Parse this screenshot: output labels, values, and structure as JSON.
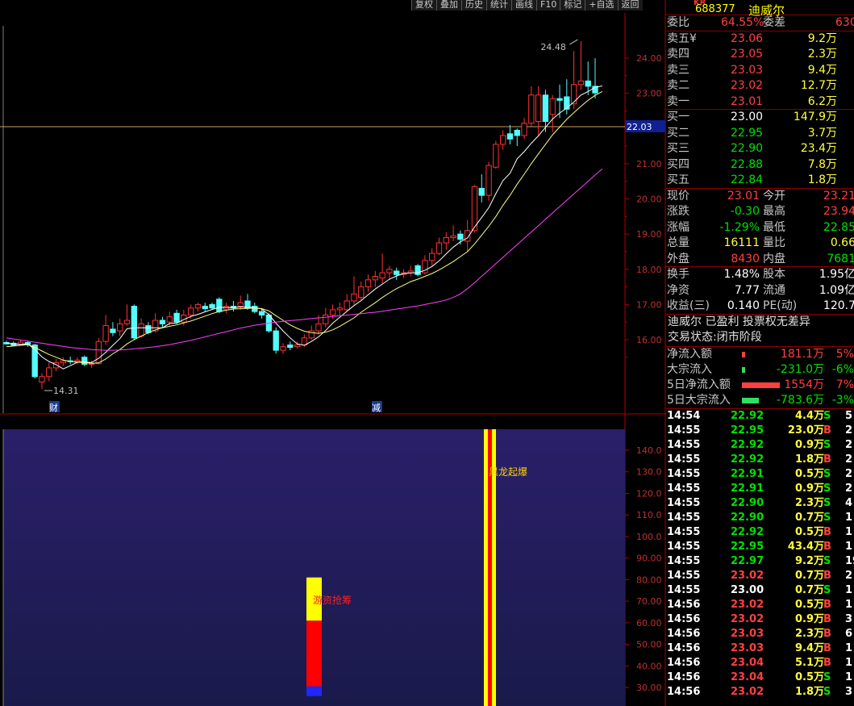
{
  "toolbar": {
    "buttons": [
      "复权",
      "叠加",
      "历史",
      "统计",
      "画线",
      "F10",
      "标记",
      "+自选",
      "返回"
    ]
  },
  "chart_data": {
    "type": "candlestick",
    "ylim": [
      15.5,
      24.8
    ],
    "y_ticks": [
      "24.00",
      "23.00",
      "22.00",
      "21.00",
      "20.00",
      "19.00",
      "18.00",
      "17.00",
      "16.00"
    ],
    "current_price_label": "22.03",
    "high_marker": "24.48",
    "low_marker": "14.31",
    "bottom_markers": [
      "财",
      "减"
    ],
    "candles": [
      {
        "o": 15.92,
        "c": 15.88,
        "h": 15.97,
        "l": 15.86
      },
      {
        "o": 15.9,
        "c": 15.84,
        "h": 15.95,
        "l": 15.82
      },
      {
        "o": 15.86,
        "c": 15.93,
        "h": 15.98,
        "l": 15.83
      },
      {
        "o": 15.92,
        "c": 15.86,
        "h": 15.96,
        "l": 15.8
      },
      {
        "o": 15.85,
        "c": 14.95,
        "h": 15.88,
        "l": 14.9
      },
      {
        "o": 14.8,
        "c": 14.95,
        "h": 15.05,
        "l": 14.6
      },
      {
        "o": 14.95,
        "c": 15.2,
        "h": 15.35,
        "l": 14.82
      },
      {
        "o": 15.2,
        "c": 15.35,
        "h": 15.45,
        "l": 15.1
      },
      {
        "o": 15.35,
        "c": 15.4,
        "h": 15.5,
        "l": 15.25
      },
      {
        "o": 15.4,
        "c": 15.38,
        "h": 15.52,
        "l": 15.3
      },
      {
        "o": 15.38,
        "c": 15.42,
        "h": 15.5,
        "l": 15.3
      },
      {
        "o": 15.5,
        "c": 15.3,
        "h": 15.55,
        "l": 15.25
      },
      {
        "o": 15.3,
        "c": 15.32,
        "h": 15.4,
        "l": 15.2
      },
      {
        "o": 15.32,
        "c": 15.95,
        "h": 16.05,
        "l": 15.3
      },
      {
        "o": 15.95,
        "c": 16.4,
        "h": 16.7,
        "l": 15.85
      },
      {
        "o": 16.3,
        "c": 16.2,
        "h": 16.5,
        "l": 16.1
      },
      {
        "o": 16.25,
        "c": 16.45,
        "h": 16.6,
        "l": 16.1
      },
      {
        "o": 16.45,
        "c": 16.55,
        "h": 17.0,
        "l": 16.4
      },
      {
        "o": 16.95,
        "c": 16.05,
        "h": 17.0,
        "l": 16.0
      },
      {
        "o": 16.1,
        "c": 16.45,
        "h": 16.6,
        "l": 16.05
      },
      {
        "o": 16.4,
        "c": 16.2,
        "h": 16.5,
        "l": 16.15
      },
      {
        "o": 16.25,
        "c": 16.55,
        "h": 16.75,
        "l": 16.2
      },
      {
        "o": 16.55,
        "c": 16.45,
        "h": 16.65,
        "l": 16.35
      },
      {
        "o": 16.5,
        "c": 16.65,
        "h": 16.8,
        "l": 16.4
      },
      {
        "o": 16.75,
        "c": 16.5,
        "h": 16.85,
        "l": 16.45
      },
      {
        "o": 16.5,
        "c": 16.7,
        "h": 16.85,
        "l": 16.4
      },
      {
        "o": 16.7,
        "c": 16.9,
        "h": 17.0,
        "l": 16.6
      },
      {
        "o": 16.9,
        "c": 17.0,
        "h": 17.05,
        "l": 16.8
      },
      {
        "o": 16.95,
        "c": 16.88,
        "h": 17.05,
        "l": 16.8
      },
      {
        "o": 17.0,
        "c": 16.9,
        "h": 17.05,
        "l": 16.85
      },
      {
        "o": 17.15,
        "c": 16.8,
        "h": 17.2,
        "l": 16.75
      },
      {
        "o": 16.85,
        "c": 16.95,
        "h": 17.05,
        "l": 16.75
      },
      {
        "o": 16.95,
        "c": 16.9,
        "h": 17.1,
        "l": 16.8
      },
      {
        "o": 16.95,
        "c": 17.05,
        "h": 17.25,
        "l": 16.85
      },
      {
        "o": 17.1,
        "c": 16.9,
        "h": 17.3,
        "l": 16.85
      },
      {
        "o": 16.95,
        "c": 16.8,
        "h": 17.05,
        "l": 16.75
      },
      {
        "o": 16.8,
        "c": 16.7,
        "h": 16.9,
        "l": 16.6
      },
      {
        "o": 16.7,
        "c": 16.25,
        "h": 16.75,
        "l": 16.2
      },
      {
        "o": 16.25,
        "c": 15.7,
        "h": 16.35,
        "l": 15.6
      },
      {
        "o": 15.7,
        "c": 15.8,
        "h": 15.9,
        "l": 15.6
      },
      {
        "o": 15.85,
        "c": 15.78,
        "h": 15.95,
        "l": 15.7
      },
      {
        "o": 15.8,
        "c": 15.85,
        "h": 15.95,
        "l": 15.75
      },
      {
        "o": 15.85,
        "c": 16.05,
        "h": 16.15,
        "l": 15.8
      },
      {
        "o": 16.05,
        "c": 16.25,
        "h": 16.4,
        "l": 16.0
      },
      {
        "o": 16.25,
        "c": 16.45,
        "h": 16.7,
        "l": 16.15
      },
      {
        "o": 16.45,
        "c": 16.7,
        "h": 16.9,
        "l": 16.35
      },
      {
        "o": 16.7,
        "c": 16.85,
        "h": 17.0,
        "l": 16.6
      },
      {
        "o": 16.85,
        "c": 16.9,
        "h": 17.05,
        "l": 16.7
      },
      {
        "o": 16.85,
        "c": 17.1,
        "h": 17.3,
        "l": 16.8
      },
      {
        "o": 17.1,
        "c": 17.3,
        "h": 17.8,
        "l": 17.0
      },
      {
        "o": 17.2,
        "c": 17.5,
        "h": 17.65,
        "l": 17.1
      },
      {
        "o": 17.5,
        "c": 17.7,
        "h": 17.85,
        "l": 17.35
      },
      {
        "o": 17.7,
        "c": 17.8,
        "h": 17.95,
        "l": 17.5
      },
      {
        "o": 17.75,
        "c": 17.9,
        "h": 18.45,
        "l": 17.6
      },
      {
        "o": 17.9,
        "c": 18.0,
        "h": 18.1,
        "l": 17.7
      },
      {
        "o": 17.95,
        "c": 17.85,
        "h": 18.05,
        "l": 17.7
      },
      {
        "o": 17.85,
        "c": 17.9,
        "h": 18.0,
        "l": 17.75
      },
      {
        "o": 17.9,
        "c": 17.95,
        "h": 18.1,
        "l": 17.8
      },
      {
        "o": 18.1,
        "c": 17.85,
        "h": 18.15,
        "l": 17.8
      },
      {
        "o": 17.9,
        "c": 18.25,
        "h": 18.4,
        "l": 17.85
      },
      {
        "o": 18.25,
        "c": 18.45,
        "h": 18.6,
        "l": 18.1
      },
      {
        "o": 18.45,
        "c": 18.75,
        "h": 18.9,
        "l": 18.4
      },
      {
        "o": 18.75,
        "c": 18.9,
        "h": 19.05,
        "l": 18.55
      },
      {
        "o": 18.9,
        "c": 18.95,
        "h": 19.25,
        "l": 18.8
      },
      {
        "o": 19.0,
        "c": 18.85,
        "h": 19.1,
        "l": 18.7
      },
      {
        "o": 18.8,
        "c": 19.1,
        "h": 19.4,
        "l": 18.5
      },
      {
        "o": 19.1,
        "c": 20.35,
        "h": 20.4,
        "l": 19.05
      },
      {
        "o": 20.3,
        "c": 20.1,
        "h": 20.7,
        "l": 19.9
      },
      {
        "o": 20.1,
        "c": 20.95,
        "h": 21.05,
        "l": 19.95
      },
      {
        "o": 20.9,
        "c": 21.55,
        "h": 21.65,
        "l": 20.85
      },
      {
        "o": 21.55,
        "c": 21.8,
        "h": 21.95,
        "l": 21.4
      },
      {
        "o": 21.85,
        "c": 21.7,
        "h": 22.1,
        "l": 21.55
      },
      {
        "o": 21.95,
        "c": 21.8,
        "h": 22.0,
        "l": 21.5
      },
      {
        "o": 21.8,
        "c": 22.15,
        "h": 22.3,
        "l": 21.7
      },
      {
        "o": 22.15,
        "c": 22.95,
        "h": 23.2,
        "l": 22.05
      },
      {
        "o": 22.2,
        "c": 22.95,
        "h": 23.2,
        "l": 21.8
      },
      {
        "o": 22.95,
        "c": 22.2,
        "h": 23.1,
        "l": 21.9
      },
      {
        "o": 22.4,
        "c": 22.85,
        "h": 22.95,
        "l": 21.9
      },
      {
        "o": 22.85,
        "c": 22.8,
        "h": 23.25,
        "l": 22.3
      },
      {
        "o": 22.9,
        "c": 22.55,
        "h": 23.4,
        "l": 22.4
      },
      {
        "o": 22.7,
        "c": 23.25,
        "h": 24.2,
        "l": 22.55
      },
      {
        "o": 23.25,
        "c": 23.35,
        "h": 24.48,
        "l": 23.1
      },
      {
        "o": 23.35,
        "c": 23.2,
        "h": 23.9,
        "l": 22.95
      },
      {
        "o": 23.2,
        "c": 23.01,
        "h": 24.0,
        "l": 22.85
      }
    ],
    "ma_series": [
      {
        "name": "MA5",
        "color": "#ffffff",
        "values": [
          15.9,
          15.88,
          15.87,
          15.88,
          15.72,
          15.51,
          15.38,
          15.29,
          15.17,
          15.26,
          15.36,
          15.37,
          15.35,
          15.47,
          15.64,
          15.84,
          16.03,
          16.31,
          16.34,
          16.34,
          16.34,
          16.34,
          16.34,
          16.46,
          16.47,
          16.57,
          16.66,
          16.72,
          16.79,
          16.86,
          16.92,
          16.91,
          16.91,
          16.93,
          16.92,
          16.92,
          16.87,
          16.71,
          16.47,
          16.25,
          16.05,
          15.88,
          15.84,
          15.95,
          16.08,
          16.26,
          16.47,
          16.64,
          16.81,
          16.97,
          17.11,
          17.28,
          17.44,
          17.58,
          17.72,
          17.81,
          17.88,
          17.9,
          17.9,
          17.97,
          18.08,
          18.24,
          18.44,
          18.63,
          18.78,
          18.89,
          19.2,
          19.47,
          19.75,
          20.15,
          20.52,
          20.73,
          21.14,
          21.34,
          21.58,
          21.79,
          22.03,
          22.27,
          22.44,
          22.58,
          22.75,
          22.95,
          23.05,
          23.17,
          23.21
        ]
      },
      {
        "name": "MA10",
        "color": "#ffff80",
        "values": [
          15.8,
          15.82,
          15.84,
          15.86,
          15.78,
          15.68,
          15.58,
          15.5,
          15.42,
          15.38,
          15.36,
          15.35,
          15.33,
          15.34,
          15.45,
          15.6,
          15.72,
          15.88,
          16.0,
          16.1,
          16.2,
          16.28,
          16.34,
          16.38,
          16.42,
          16.48,
          16.53,
          16.6,
          16.67,
          16.74,
          16.8,
          16.84,
          16.87,
          16.88,
          16.89,
          16.9,
          16.88,
          16.82,
          16.68,
          16.55,
          16.42,
          16.32,
          16.24,
          16.2,
          16.18,
          16.21,
          16.28,
          16.38,
          16.5,
          16.62,
          16.78,
          16.92,
          17.05,
          17.2,
          17.33,
          17.45,
          17.55,
          17.65,
          17.72,
          17.8,
          17.88,
          17.98,
          18.1,
          18.22,
          18.36,
          18.5,
          18.72,
          18.97,
          19.22,
          19.5,
          19.82,
          20.1,
          20.42,
          20.7,
          21.0,
          21.28,
          21.55,
          21.82,
          22.04,
          22.26,
          22.45,
          22.63,
          22.8,
          22.94,
          23.05
        ]
      },
      {
        "name": "MA60",
        "color": "#ff40ff",
        "values": [
          16.05,
          16.02,
          15.99,
          15.96,
          15.93,
          15.9,
          15.87,
          15.84,
          15.81,
          15.78,
          15.76,
          15.74,
          15.72,
          15.71,
          15.7,
          15.7,
          15.71,
          15.72,
          15.74,
          15.76,
          15.78,
          15.8,
          15.83,
          15.86,
          15.9,
          15.94,
          15.98,
          16.03,
          16.08,
          16.13,
          16.18,
          16.23,
          16.28,
          16.33,
          16.37,
          16.41,
          16.44,
          16.47,
          16.5,
          16.52,
          16.54,
          16.56,
          16.58,
          16.6,
          16.62,
          16.64,
          16.66,
          16.68,
          16.7,
          16.72,
          16.74,
          16.76,
          16.78,
          16.81,
          16.84,
          16.87,
          16.9,
          16.93,
          16.96,
          17.0,
          17.04,
          17.08,
          17.13,
          17.2,
          17.3,
          17.45,
          17.62,
          17.8,
          17.98,
          18.16,
          18.34,
          18.52,
          18.7,
          18.88,
          19.06,
          19.24,
          19.42,
          19.6,
          19.78,
          19.96,
          20.14,
          20.32,
          20.5,
          20.68,
          20.85
        ]
      }
    ],
    "indicator": {
      "y_ticks": [
        "140.0",
        "130.0",
        "120.0",
        "110.0",
        "100.0",
        "90.00",
        "80.00",
        "70.00",
        "60.00",
        "50.00",
        "40.00",
        "30.00"
      ],
      "ylim": [
        26,
        150
      ],
      "labels": [
        "游资抢筹",
        "黑龙起爆"
      ],
      "bar_segments": [
        {
          "name": "blue-segment",
          "from": 26,
          "to": 30.5,
          "color": "#1f28ff"
        },
        {
          "name": "red-segment",
          "from": 30.5,
          "to": 61,
          "color": "#ff0000"
        },
        {
          "name": "yellow-segment",
          "from": 61,
          "to": 81,
          "color": "#ffff00"
        }
      ],
      "vertical_band": {
        "outer_color": "#ffff00",
        "inner_color": "#ff0000"
      }
    }
  },
  "panel": {
    "market_tag": "KR",
    "code": "688377",
    "name": "迪威尔",
    "ratio": {
      "label1": "委比",
      "value1": "64.55%",
      "label2": "委差",
      "value2": "630"
    },
    "asks": [
      {
        "label": "卖五",
        "mark": "¥",
        "price": "23.06",
        "vol": "9.2万"
      },
      {
        "label": "卖四",
        "mark": "",
        "price": "23.05",
        "vol": "2.3万"
      },
      {
        "label": "卖三",
        "mark": "",
        "price": "23.03",
        "vol": "9.4万"
      },
      {
        "label": "卖二",
        "mark": "",
        "price": "23.02",
        "vol": "12.7万"
      },
      {
        "label": "卖一",
        "mark": "",
        "price": "23.01",
        "vol": "6.2万"
      }
    ],
    "bids": [
      {
        "label": "买一",
        "price": "23.00",
        "vol": "147.9万"
      },
      {
        "label": "买二",
        "price": "22.95",
        "vol": "3.7万"
      },
      {
        "label": "买三",
        "price": "22.90",
        "vol": "23.4万"
      },
      {
        "label": "买四",
        "price": "22.88",
        "vol": "7.8万"
      },
      {
        "label": "买五",
        "price": "22.84",
        "vol": "1.8万"
      }
    ],
    "quotes": [
      {
        "l1": "现价",
        "v1": "23.01",
        "c1": "red",
        "l2": "今开",
        "v2": "23.21",
        "c2": "red"
      },
      {
        "l1": "涨跌",
        "v1": "-0.30",
        "c1": "green",
        "l2": "最高",
        "v2": "23.94",
        "c2": "red"
      },
      {
        "l1": "涨幅",
        "v1": "-1.29%",
        "c1": "green",
        "l2": "最低",
        "v2": "22.85",
        "c2": "green"
      },
      {
        "l1": "总量",
        "v1": "16111",
        "c1": "yellow",
        "l2": "量比",
        "v2": "0.66",
        "c2": "yellow"
      },
      {
        "l1": "外盘",
        "v1": "8430",
        "c1": "red",
        "l2": "内盘",
        "v2": "7681",
        "c2": "green"
      }
    ],
    "stats": [
      {
        "l1": "换手",
        "v1": "1.48%",
        "l2": "股本",
        "v2": "1.95亿"
      },
      {
        "l1": "净资",
        "v1": "7.77",
        "l2": "流通",
        "v2": "1.09亿"
      },
      {
        "l1": "收益(三)",
        "v1": "0.140",
        "l2": "PE(动)",
        "v2": "120.7"
      }
    ],
    "note_line1": "迪威尔 已盈利 投票权无差异",
    "note_line2": "交易状态:闭市阶段",
    "flows": [
      {
        "label": "净流入额",
        "value": "181.1万",
        "pct": "5%",
        "color": "red",
        "bar": 0.04
      },
      {
        "label": "大宗流入",
        "value": "-231.0万",
        "pct": "-6%",
        "color": "green",
        "bar": 0.04
      },
      {
        "label": "5日净流入额",
        "value": "1554万",
        "pct": "7%",
        "color": "red",
        "bar": 0.9
      },
      {
        "label": "5日大宗流入",
        "value": "-783.6万",
        "pct": "-3%",
        "color": "green",
        "bar": 0.4
      }
    ],
    "ticks": [
      {
        "t": "14:54",
        "p": "22.92",
        "v": "4.4万",
        "s": "S",
        "n": "5"
      },
      {
        "t": "14:55",
        "p": "22.95",
        "v": "23.0万",
        "s": "B",
        "n": "2"
      },
      {
        "t": "14:55",
        "p": "22.92",
        "v": "0.9万",
        "s": "S",
        "n": "2"
      },
      {
        "t": "14:55",
        "p": "22.92",
        "v": "1.8万",
        "s": "B",
        "n": "2"
      },
      {
        "t": "14:55",
        "p": "22.91",
        "v": "0.5万",
        "s": "S",
        "n": "2"
      },
      {
        "t": "14:55",
        "p": "22.91",
        "v": "0.9万",
        "s": "S",
        "n": "2"
      },
      {
        "t": "14:55",
        "p": "22.90",
        "v": "2.3万",
        "s": "S",
        "n": "4"
      },
      {
        "t": "14:55",
        "p": "22.90",
        "v": "0.7万",
        "s": "S",
        "n": "1"
      },
      {
        "t": "14:55",
        "p": "22.92",
        "v": "0.5万",
        "s": "B",
        "n": "1"
      },
      {
        "t": "14:55",
        "p": "22.95",
        "v": "43.4万",
        "s": "B",
        "n": "1"
      },
      {
        "t": "14:55",
        "p": "22.97",
        "v": "9.2万",
        "s": "S",
        "n": "19"
      },
      {
        "t": "14:55",
        "p": "23.02",
        "v": "0.7万",
        "s": "B",
        "n": "2"
      },
      {
        "t": "14:55",
        "p": "23.00",
        "v": "0.7万",
        "s": "S",
        "n": "1"
      },
      {
        "t": "14:56",
        "p": "23.02",
        "v": "0.5万",
        "s": "B",
        "n": "1"
      },
      {
        "t": "14:56",
        "p": "23.02",
        "v": "0.9万",
        "s": "B",
        "n": "3"
      },
      {
        "t": "14:56",
        "p": "23.03",
        "v": "2.3万",
        "s": "B",
        "n": "6"
      },
      {
        "t": "14:56",
        "p": "23.03",
        "v": "9.4万",
        "s": "B",
        "n": "1"
      },
      {
        "t": "14:56",
        "p": "23.04",
        "v": "5.1万",
        "s": "B",
        "n": "1"
      },
      {
        "t": "14:56",
        "p": "23.04",
        "v": "0.5万",
        "s": "S",
        "n": "1"
      },
      {
        "t": "14:56",
        "p": "23.02",
        "v": "1.8万",
        "s": "S",
        "n": "3"
      }
    ]
  }
}
